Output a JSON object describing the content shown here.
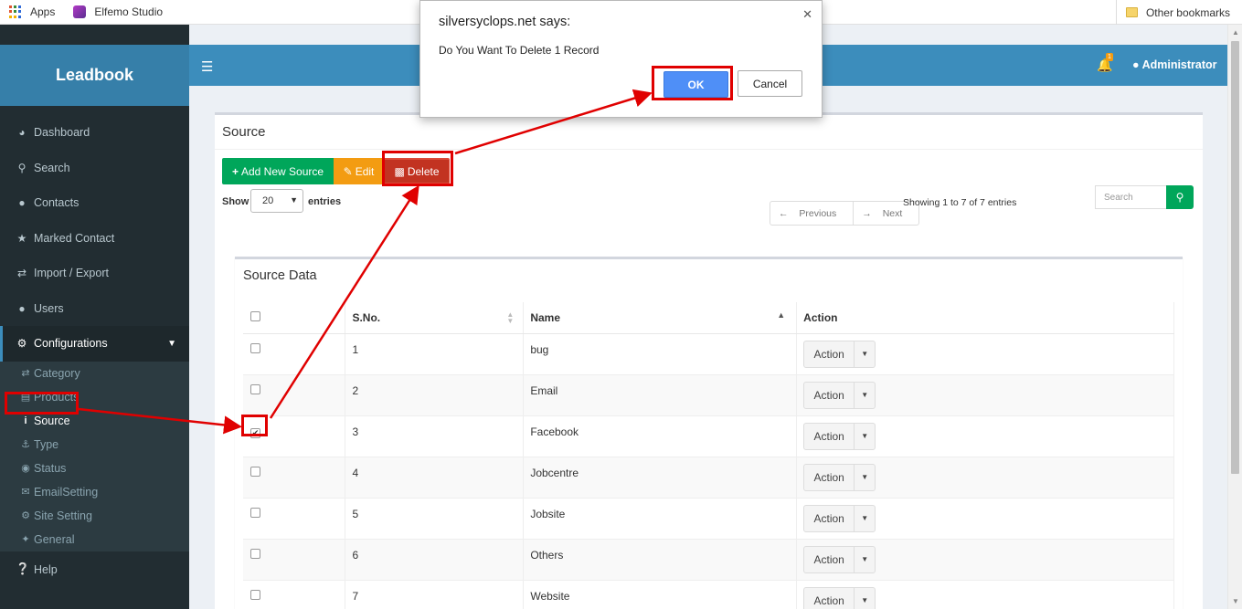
{
  "bookmarks": {
    "apps": "Apps",
    "elfemo": "Elfemo Studio",
    "other": "Other bookmarks"
  },
  "app": {
    "brand": "Leadbook",
    "user": "Administrator",
    "notifications": "1"
  },
  "sidebar": {
    "items": [
      {
        "label": "Dashboard",
        "icon": "dashboard-icon"
      },
      {
        "label": "Search",
        "icon": "search-icon"
      },
      {
        "label": "Contacts",
        "icon": "users-icon"
      },
      {
        "label": "Marked Contact",
        "icon": "star-icon"
      },
      {
        "label": "Import / Export",
        "icon": "exchange-icon"
      },
      {
        "label": "Users",
        "icon": "user-icon"
      }
    ],
    "configurations": "Configurations",
    "submenu": [
      {
        "label": "Category",
        "icon": "random-icon"
      },
      {
        "label": "Products",
        "icon": "cart-icon"
      },
      {
        "label": "Source",
        "icon": "info-icon"
      },
      {
        "label": "Type",
        "icon": "anchor-icon"
      },
      {
        "label": "Status",
        "icon": "eye-icon"
      },
      {
        "label": "EmailSetting",
        "icon": "envelope-icon"
      },
      {
        "label": "Site Setting",
        "icon": "gear-icon"
      },
      {
        "label": "General",
        "icon": "wrench-icon"
      }
    ],
    "help": "Help"
  },
  "page": {
    "title": "Source",
    "add_label": "Add New Source",
    "edit_label": "Edit",
    "delete_label": "Delete",
    "show_label": "Show",
    "page_size": "20",
    "entries_label": "entries",
    "prev_label": "Previous",
    "next_label": "Next",
    "showing_text": "Showing 1 to 7 of 7 entries",
    "search_placeholder": "Search"
  },
  "table": {
    "title": "Source Data",
    "headers": {
      "sno": "S.No.",
      "name": "Name",
      "action": "Action"
    },
    "action_label": "Action",
    "rows": [
      {
        "sno": "1",
        "name": "bug",
        "checked": false
      },
      {
        "sno": "2",
        "name": "Email",
        "checked": false
      },
      {
        "sno": "3",
        "name": "Facebook",
        "checked": true
      },
      {
        "sno": "4",
        "name": "Jobcentre",
        "checked": false
      },
      {
        "sno": "5",
        "name": "Jobsite",
        "checked": false
      },
      {
        "sno": "6",
        "name": "Others",
        "checked": false
      },
      {
        "sno": "7",
        "name": "Website",
        "checked": false
      }
    ]
  },
  "dialog": {
    "title": "silversyclops.net says:",
    "message": "Do You Want To Delete 1 Record",
    "ok": "OK",
    "cancel": "Cancel"
  },
  "colors": {
    "header": "#3c8dbc",
    "brand": "#367fa9",
    "sidebar": "#222d32",
    "annotation": "#e00000"
  }
}
